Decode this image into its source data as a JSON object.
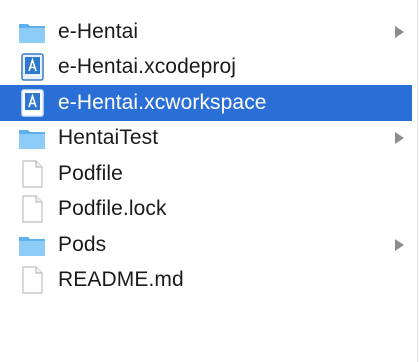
{
  "colors": {
    "selection": "#2a6fd6",
    "folder": "#7cc1f5",
    "chevron": "#8d8d8d"
  },
  "items": [
    {
      "label": "e-Hentai",
      "icon": "folder-icon",
      "has_children": true,
      "selected": false
    },
    {
      "label": "e-Hentai.xcodeproj",
      "icon": "xcode-project-icon",
      "has_children": false,
      "selected": false
    },
    {
      "label": "e-Hentai.xcworkspace",
      "icon": "xcode-workspace-icon",
      "has_children": false,
      "selected": true
    },
    {
      "label": "HentaiTest",
      "icon": "folder-icon",
      "has_children": true,
      "selected": false
    },
    {
      "label": "Podfile",
      "icon": "document-icon",
      "has_children": false,
      "selected": false
    },
    {
      "label": "Podfile.lock",
      "icon": "document-icon",
      "has_children": false,
      "selected": false
    },
    {
      "label": "Pods",
      "icon": "folder-icon",
      "has_children": true,
      "selected": false
    },
    {
      "label": "README.md",
      "icon": "document-icon",
      "has_children": false,
      "selected": false
    }
  ]
}
